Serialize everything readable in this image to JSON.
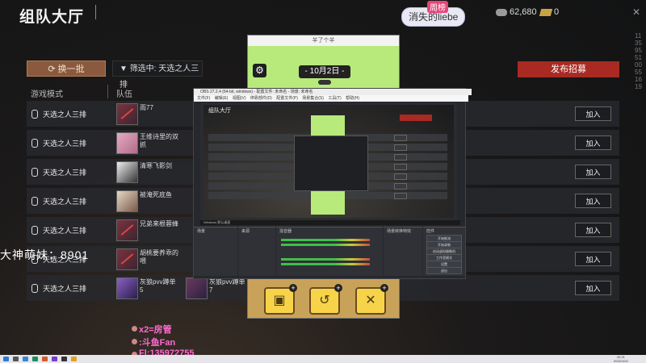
{
  "header": {
    "title": "组队大厅",
    "streamer_tag": "周榜",
    "streamer_name": "消失的liebe",
    "coins": "62,680",
    "tickets": "0",
    "vertical_id": "1135955100551619"
  },
  "toolbar": {
    "refresh_label": "换一批",
    "filter_label": "筛选中: 天选之人三排",
    "post_label": "发布招募"
  },
  "table": {
    "col_mode": "游戏模式",
    "col_team": "队伍",
    "join_label": "加入",
    "rows": [
      {
        "mode": "天选之人三排",
        "player": "雨77",
        "player2": ""
      },
      {
        "mode": "天选之人三排",
        "player": "王维诗里的双抓",
        "player2": ""
      },
      {
        "mode": "天选之人三排",
        "player": "清寒飞影剑",
        "player2": ""
      },
      {
        "mode": "天选之人三排",
        "player": "被淹死底鱼",
        "player2": ""
      },
      {
        "mode": "天选之人三排",
        "player": "兄弟来根蓉蜂",
        "player2": ""
      },
      {
        "mode": "天选之人三排",
        "player": "胡桃要养乖的喂",
        "player2": ""
      },
      {
        "mode": "天选之人三排",
        "player": "灰狼pvv蹲单5",
        "player2": "灰狼pvv蹲单7"
      }
    ]
  },
  "game": {
    "window_title": "羊了个羊",
    "date": "- 10月2日 -",
    "buttons": [
      "移出",
      "撤回",
      "洗牌"
    ]
  },
  "obs": {
    "title": "OBS 27.2.4 (64-bit, windows) - 配置文件: 未命名 - 场景: 未命名",
    "menu": "文件(F) 编辑(E) 视图(V) 停靠部件(D) 配置文件(P) 场景集合(S) 工具(T) 帮助(H)",
    "inner_title": "组队大厅",
    "status": "Windows 默认桌面",
    "docks": {
      "scenes": "场景",
      "sources": "来源",
      "mixer": "混音器",
      "transitions": "场景转换特效",
      "controls": "控件"
    },
    "control_buttons": [
      "开始推流",
      "开始录制",
      "启动虚拟摄像机",
      "工作室模式",
      "设置",
      "退出"
    ]
  },
  "overlays": {
    "side_text": "大神萌妹：8901",
    "line1": "x2=房管",
    "line2": ":斗鱼Fan",
    "line3": "Fl:135972755"
  },
  "taskbar": {
    "time": "20:21",
    "date": "2022/10/2"
  }
}
